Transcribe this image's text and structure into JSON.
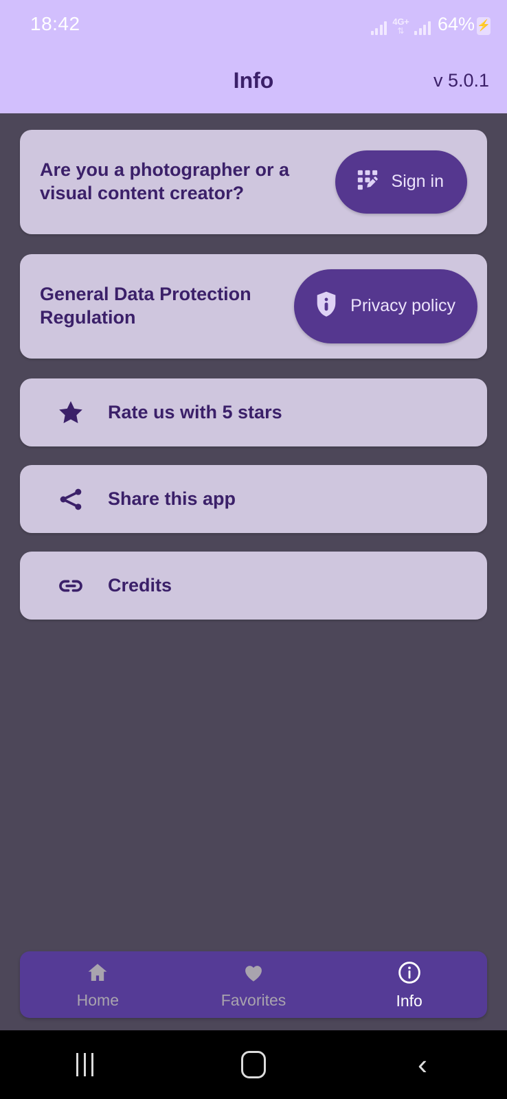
{
  "status_bar": {
    "time": "18:42",
    "network_label": "4G+",
    "network_arrows": "⇅",
    "battery_percent": "64%",
    "battery_icon": "battery-charging-icon",
    "signal_icon": "signal-bars-icon"
  },
  "app_bar": {
    "title": "Info",
    "version": "v 5.0.1"
  },
  "cards": {
    "signin": {
      "text": "Are you a photographer or a visual content creator?",
      "button_label": "Sign in",
      "button_icon": "grid-edit-icon"
    },
    "privacy": {
      "text": "General Data Protection Regulation",
      "button_label": "Privacy policy",
      "button_icon": "shield-info-icon"
    }
  },
  "list_items": [
    {
      "label": "Rate us with 5 stars",
      "icon": "star-icon"
    },
    {
      "label": "Share this app",
      "icon": "share-icon"
    },
    {
      "label": "Credits",
      "icon": "link-icon"
    }
  ],
  "bottom_nav": {
    "items": [
      {
        "label": "Home",
        "icon": "home-icon",
        "active": false
      },
      {
        "label": "Favorites",
        "icon": "heart-icon",
        "active": false
      },
      {
        "label": "Info",
        "icon": "info-circle-icon",
        "active": true
      }
    ]
  },
  "android_nav": {
    "recents": "recents-icon",
    "home": "home-square-icon",
    "back": "back-chevron-icon"
  },
  "colors": {
    "header": "#d2bffd",
    "background": "#4d4759",
    "card": "#cfc6de",
    "accent": "#55378f",
    "nav_bar": "#553b96",
    "text_dark": "#3b2069"
  }
}
